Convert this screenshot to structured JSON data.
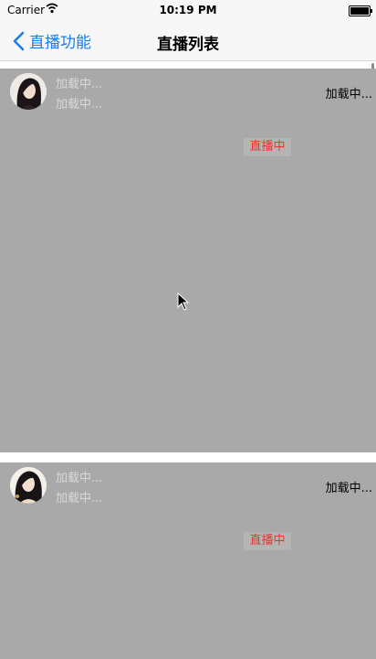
{
  "status_bar": {
    "carrier": "Carrier",
    "time": "10:19 PM"
  },
  "nav": {
    "back_label": "直播功能",
    "title": "直播列表"
  },
  "cells": [
    {
      "name": "加载中...",
      "city": "加载中...",
      "count": "加载中...",
      "live_label": "直播中"
    },
    {
      "name": "加载中...",
      "city": "加载中...",
      "count": "加载中...",
      "live_label": "直播中"
    }
  ],
  "colors": {
    "accent": "#1a7ee8",
    "cell_bg": "#a9a9a9",
    "live_text": "#e8352f"
  },
  "icons": [
    "wifi-icon",
    "battery-icon",
    "chevron-left-icon",
    "mouse-cursor-icon"
  ]
}
